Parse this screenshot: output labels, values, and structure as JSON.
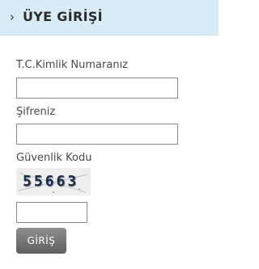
{
  "header": {
    "chevron": "›",
    "title": "ÜYE GİRİŞİ"
  },
  "form": {
    "tc_label": "T.C.Kimlik Numaranız",
    "tc_value": "",
    "password_label": "Şifreniz",
    "password_value": "",
    "security_label": "Güvenlik Kodu",
    "captcha_text": "55663",
    "captcha_value": "",
    "submit_label": "GİRİŞ"
  },
  "colors": {
    "header_bg": "#d8ecf7",
    "button_bg": "#707070"
  },
  "icons": {
    "header": "chevron-right-icon"
  }
}
